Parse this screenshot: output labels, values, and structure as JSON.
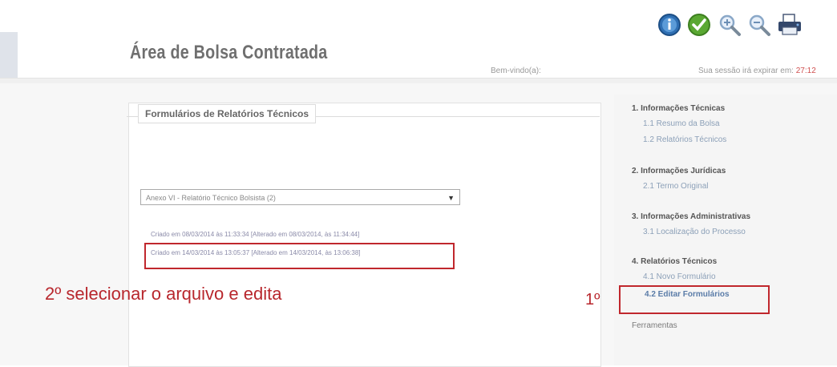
{
  "header": {
    "title": "Área de Bolsa Contratada",
    "user_label": "Bem-vindo(a):",
    "session_prefix": "Sua sessão irá expirar em:",
    "session_time": "27:12",
    "icons": [
      "info-icon",
      "check-icon",
      "zoom-in-icon",
      "zoom-out-icon",
      "print-icon"
    ]
  },
  "form": {
    "legend": "Formulários de Relatórios Técnicos",
    "select_value": "Anexo VI - Relatório Técnico Bolsista (2)",
    "files": [
      "Criado em 08/03/2014 às 11:33:34  [Alterado em 08/03/2014, às 11:34:44]",
      "Criado em 14/03/2014 às 13:05:37  [Alterado em 14/03/2014, às 13:06:38]"
    ]
  },
  "annotations": {
    "step2": "2º selecionar o arquivo e edita",
    "step1": "1º"
  },
  "sidebar": {
    "sections": [
      {
        "title": "1. Informações Técnicas",
        "items": [
          "1.1 Resumo da Bolsa",
          "1.2 Relatórios Técnicos"
        ]
      },
      {
        "title": "2. Informações Jurídicas",
        "items": [
          "2.1 Termo Original"
        ]
      },
      {
        "title": "3. Informações Administrativas",
        "items": [
          "3.1 Localização do Processo"
        ]
      },
      {
        "title": "4. Relatórios Técnicos",
        "items": [
          "4.1 Novo Formulário",
          "4.2 Editar Formulários"
        ]
      }
    ],
    "footer": "Ferramentas"
  },
  "colors": {
    "annotation_red": "#c0272d",
    "link_blue": "#5a7ca8"
  }
}
